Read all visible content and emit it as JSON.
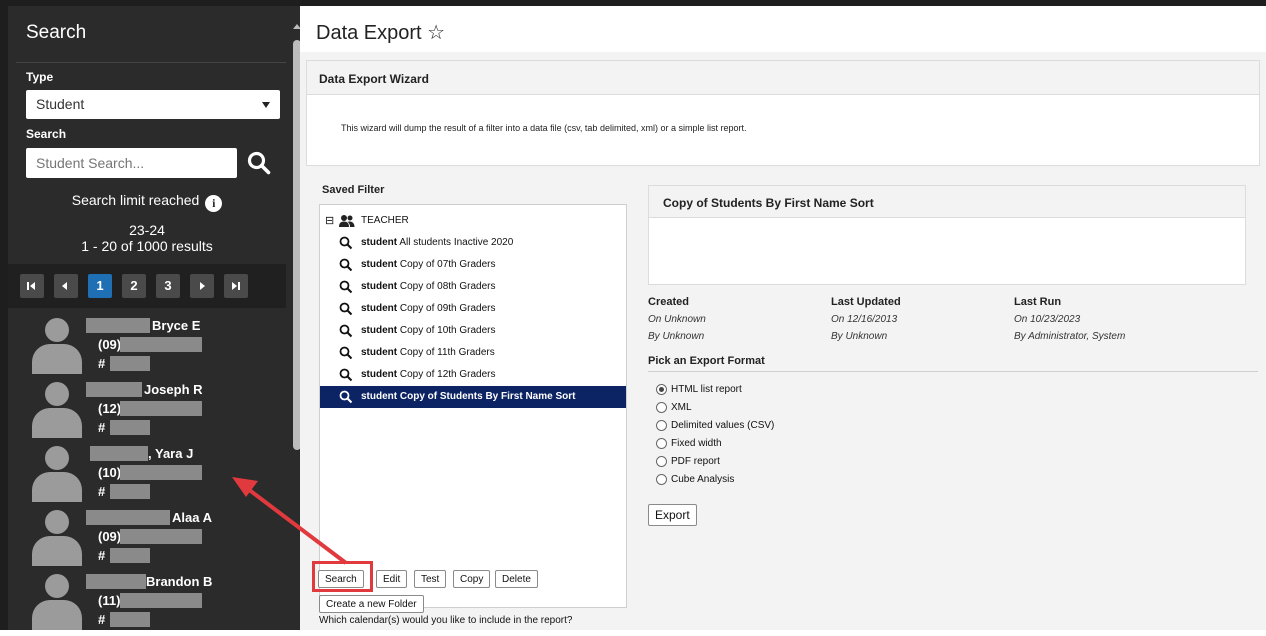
{
  "sidebar": {
    "title": "Search",
    "type_label": "Type",
    "type_value": "Student",
    "search_label": "Search",
    "search_placeholder": "Student Search...",
    "limit_text": "Search limit reached",
    "info_glyph": "i",
    "school_year": "23-24",
    "result_count": "1 - 20 of 1000 results",
    "pages": [
      "1",
      "2",
      "3"
    ],
    "active_page": "1",
    "results": [
      {
        "name": "Bryce E",
        "grade": "(09)",
        "hash": "#"
      },
      {
        "name": "Joseph R",
        "grade": "(12)",
        "hash": "#"
      },
      {
        "name": ", Yara J",
        "grade": "(10)",
        "hash": "#"
      },
      {
        "name": "Alaa A",
        "grade": "(09)",
        "hash": "#"
      },
      {
        "name": "Brandon B",
        "grade": "(11)",
        "hash": "#"
      }
    ]
  },
  "header": {
    "title": "Data Export",
    "favorite_glyph": "☆"
  },
  "wizard": {
    "heading": "Data Export Wizard",
    "description": "This wizard will dump the result of a filter into a data file (csv, tab delimited, xml) or a simple list report."
  },
  "saved_filter": {
    "label": "Saved Filter",
    "expander": "⊟",
    "group": "TEACHER",
    "items": [
      {
        "kind": "student",
        "name": "All students Inactive 2020"
      },
      {
        "kind": "student",
        "name": "Copy of 07th Graders"
      },
      {
        "kind": "student",
        "name": "Copy of 08th Graders"
      },
      {
        "kind": "student",
        "name": "Copy of 09th Graders"
      },
      {
        "kind": "student",
        "name": "Copy of 10th Graders"
      },
      {
        "kind": "student",
        "name": "Copy of 11th Graders"
      },
      {
        "kind": "student",
        "name": "Copy of 12th Graders"
      },
      {
        "kind": "student",
        "name": "Copy of Students By First Name Sort"
      }
    ],
    "selected_index": 7,
    "buttons": {
      "search": "Search",
      "edit": "Edit",
      "test": "Test",
      "copy": "Copy",
      "delete": "Delete",
      "new_folder": "Create a new Folder"
    },
    "calendar_question": "Which calendar(s) would you like to include in the report?"
  },
  "detail": {
    "title": "Copy of Students By First Name Sort",
    "created_label": "Created",
    "created_on": "On Unknown",
    "created_by": "By Unknown",
    "updated_label": "Last Updated",
    "updated_on": "On 12/16/2013",
    "updated_by": "By Unknown",
    "run_label": "Last Run",
    "run_on": "On 10/23/2023",
    "run_by": "By Administrator, System"
  },
  "export": {
    "heading": "Pick an Export Format",
    "formats": [
      "HTML list report",
      "XML",
      "Delimited values (CSV)",
      "Fixed width",
      "PDF report",
      "Cube Analysis"
    ],
    "selected_format": "HTML list report",
    "button": "Export"
  },
  "colors": {
    "sidebar_bg": "#2b2b2b",
    "accent_blue": "#1f6fb5",
    "selected_row": "#0d2464",
    "annotation_red": "#e0393e"
  }
}
